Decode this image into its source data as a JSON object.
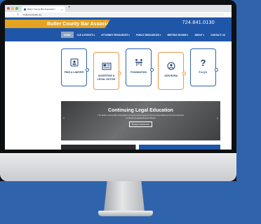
{
  "browser": {
    "tab_title": "Butler County Bar Association",
    "tab_close": "×",
    "new_tab": "+",
    "url": "butlercountybar.org",
    "back": "←",
    "forward": "→",
    "reload": "↻"
  },
  "site": {
    "name": "Butler County Bar Association",
    "phone": "724.841.0130",
    "nav": [
      {
        "label": "HOME",
        "active": true
      },
      {
        "label": "CLE & EVENTS ▾"
      },
      {
        "label": "ATTORNEY RESOURCES ▾"
      },
      {
        "label": "PUBLIC RESOURCES ▾"
      },
      {
        "label": "MEETING ROOMS ▾"
      },
      {
        "label": "ABOUT ▾"
      },
      {
        "label": "CONTACT US"
      }
    ]
  },
  "features": [
    {
      "label": "FIND A LAWYER",
      "icon": "id-card-icon",
      "color": "blue"
    },
    {
      "label": "ADVERTISE A LEGAL NOTICE",
      "icon": "newspaper-icon",
      "color": "orange"
    },
    {
      "label": "FOUNDATION",
      "icon": "people-table-icon",
      "color": "blue"
    },
    {
      "label": "JOIN BCBA",
      "icon": "user-circle-icon",
      "color": "orange"
    },
    {
      "label": "F.A.Q's",
      "icon": "question-mark-icon",
      "color": "blue"
    }
  ],
  "hero": {
    "title": "Continuing Legal Education",
    "text": "The Butler County Bar Association presents CLE programs that are accredited by the Pennsylvania Continuing Legal Education Board",
    "cta": "Browse CLE Events",
    "prev": "‹",
    "next": "›"
  },
  "colors": {
    "brand_blue": "#1f56a8",
    "accent_gold": "#e3a323",
    "accent_orange": "#e69a44",
    "background": "#2f64ad"
  }
}
